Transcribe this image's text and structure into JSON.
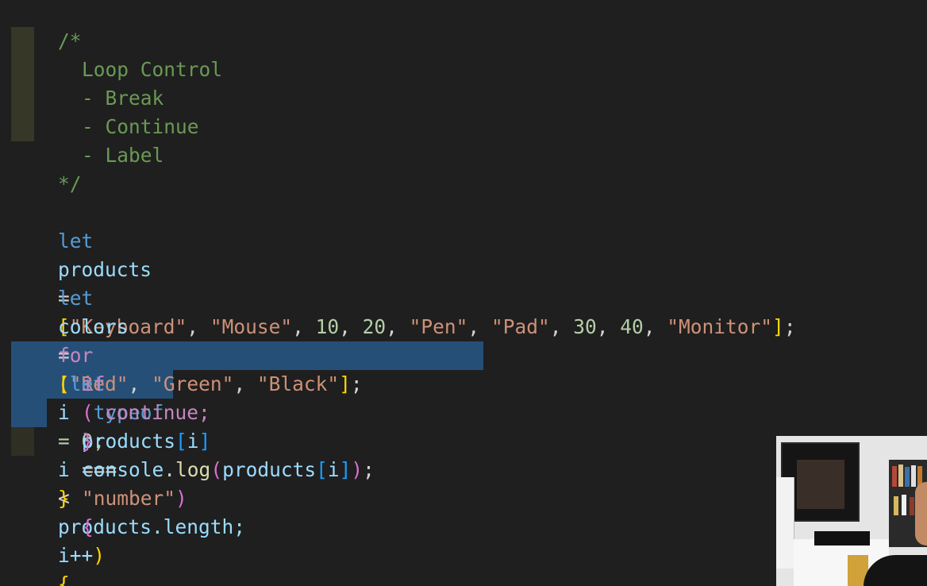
{
  "code": {
    "comment_open": "/*",
    "comment_title": "Loop Control",
    "comment_item_1": "- Break",
    "comment_item_2": "- Continue",
    "comment_item_3": "- Label",
    "comment_close": "*/",
    "line_products": {
      "kw": "let",
      "name": "products",
      "eq": "=",
      "open": "[",
      "items": [
        "\"Keyboard\"",
        "\"Mouse\"",
        "10",
        "20",
        "\"Pen\"",
        "\"Pad\"",
        "30",
        "40",
        "\"Monitor\""
      ],
      "close": "]",
      "semi": ";"
    },
    "line_colors": {
      "kw": "let",
      "name": "colors",
      "eq": "=",
      "open": "[",
      "items": [
        "\"Red\"",
        "\"Green\"",
        "\"Black\""
      ],
      "close": "]",
      "semi": ";"
    },
    "line_for": {
      "kw": "for",
      "open_paren": "(",
      "let": "let",
      "i": "i",
      "init": "= 0;",
      "cond_i": "i",
      "lt": "<",
      "obj": "products",
      "prop": ".length;",
      "inc": "i++",
      "close_paren": ")",
      "brace": "{"
    },
    "line_if": {
      "kw": "if",
      "open_paren": "(",
      "typeof": "typeof",
      "obj": "products",
      "idx_open": "[",
      "idx": "i",
      "idx_close": "]",
      "op": "===",
      "str": "\"number\"",
      "close_paren": ")",
      "brace": "{"
    },
    "line_continue": "continue;",
    "line_if_close": "}",
    "line_log": {
      "obj": "console",
      "dot": ".",
      "fn": "log",
      "open_paren": "(",
      "arg": "products",
      "idx_open": "[",
      "idx": "i",
      "idx_close": "]",
      "close_paren": ")",
      "semi": ";"
    },
    "line_for_close": "}"
  },
  "colors": {
    "background": "#1f1f1f",
    "comment": "#6a9955",
    "keyword": "#569cd6",
    "control": "#c586c0",
    "variable": "#9cdcfe",
    "string": "#ce9178",
    "number": "#b5cea8",
    "bracket_1": "#ffd700",
    "bracket_2": "#da70d6",
    "bracket_3": "#179fff",
    "function": "#dcdcaa",
    "selection": "#264f78"
  },
  "webcam": {
    "icon": "webcam-overlay"
  }
}
